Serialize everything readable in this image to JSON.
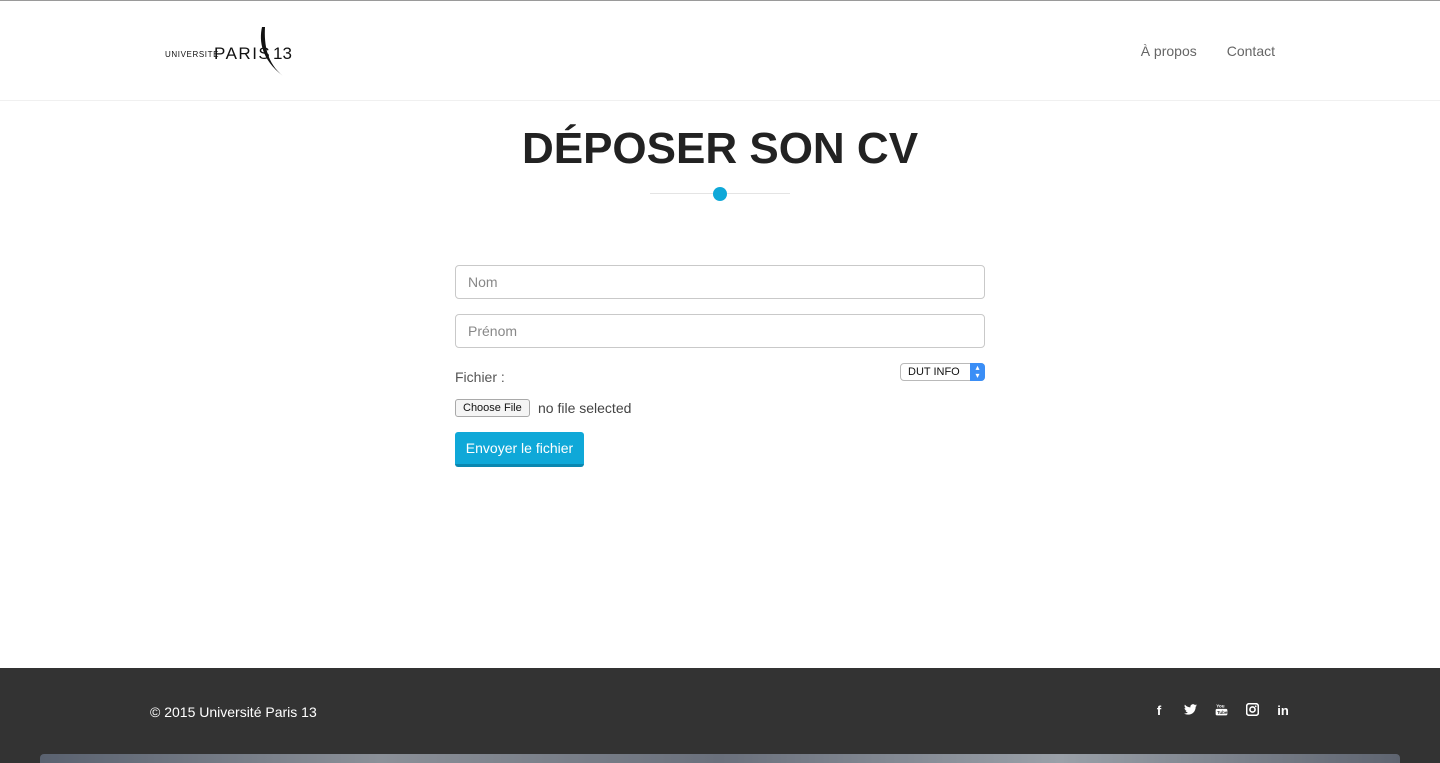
{
  "header": {
    "logo": {
      "prefix": "UNIVERSITÉ",
      "name": "PARIS",
      "number": "13"
    },
    "nav": [
      {
        "label": "À propos"
      },
      {
        "label": "Contact"
      }
    ]
  },
  "main": {
    "title": "DÉPOSER SON CV",
    "accent_color": "#0fa8d8",
    "form": {
      "nom_placeholder": "Nom",
      "prenom_placeholder": "Prénom",
      "file_label": "Fichier :",
      "program_select": "DUT INFO",
      "choose_file_label": "Choose File",
      "no_file_text": "no file selected",
      "submit_label": "Envoyer le fichier"
    }
  },
  "footer": {
    "copyright": "© 2015 Université Paris 13",
    "social": [
      {
        "icon": "facebook-icon",
        "glyph": "f"
      },
      {
        "icon": "twitter-icon",
        "glyph": "t"
      },
      {
        "icon": "youtube-icon",
        "glyph": "▶"
      },
      {
        "icon": "instagram-icon",
        "glyph": "◙"
      },
      {
        "icon": "linkedin-icon",
        "glyph": "in"
      }
    ]
  }
}
